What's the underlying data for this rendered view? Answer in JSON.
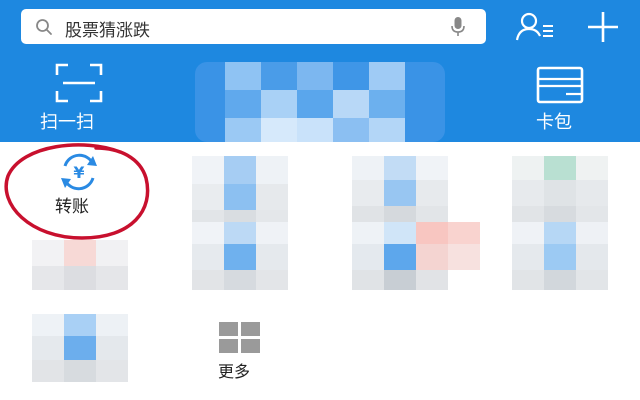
{
  "search": {
    "placeholder": "股票猜涨跌"
  },
  "top_actions": {
    "scan_label": "扫一扫",
    "card_label": "卡包"
  },
  "grid": {
    "transfer_label": "转账",
    "more_label": "更多"
  },
  "colors": {
    "header_blue": "#1e88e0",
    "accent_blue": "#2a8ae3",
    "annotation_red": "#c8102e"
  }
}
